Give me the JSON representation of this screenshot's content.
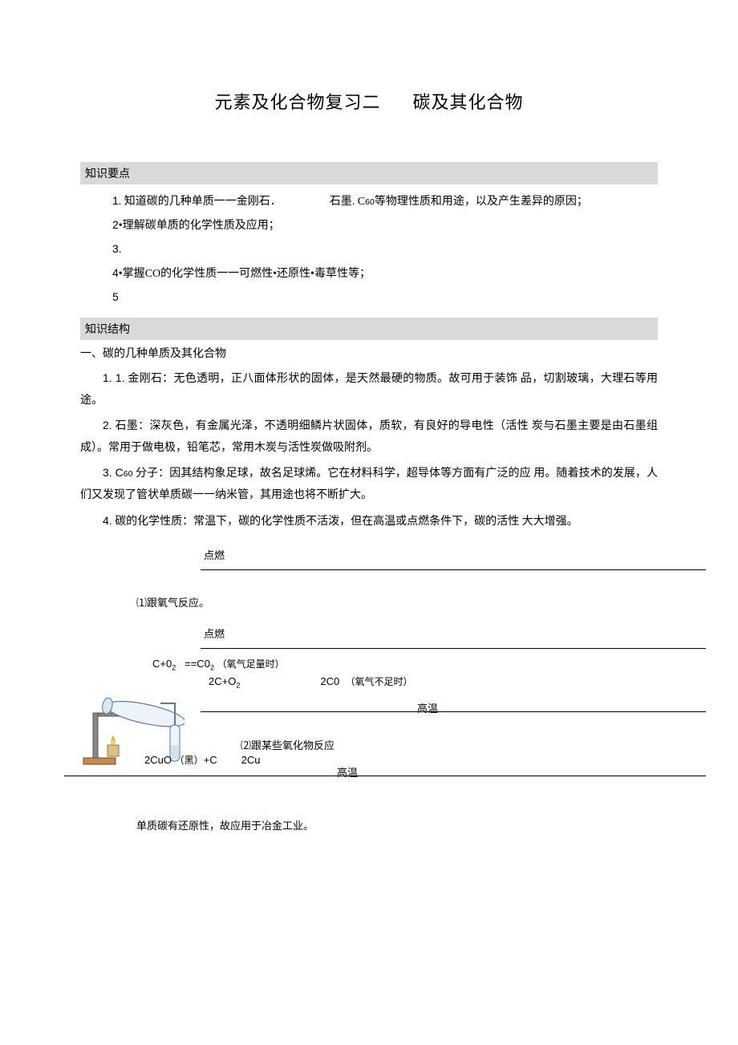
{
  "title": {
    "left": "元素及化合物复习二",
    "right": "碳及其化合物"
  },
  "sec1_header": "知识要点",
  "req": {
    "n1": "1",
    "t1a": " . 知道碳的几种单质一一金刚石．",
    "t1b": "石墨. C",
    "t1c": "60",
    "t1d": "等物理性质和用途，以及产生差异的原因；",
    "n2": "2",
    "t2": " •理解碳单质的化学性质及应用；",
    "n3": "3.",
    "n4": "4",
    "t4": "•掌握CO的化学性质一一可燃性•还原性•毒草性等；",
    "n5": "5"
  },
  "sec2_header": "知识结构",
  "subhead1": "一、碳的几种单质及其化合物",
  "p1": {
    "num": "1.   1.",
    "text": "金刚石：无色透明，正八面体形状的固体，是天然最硬的物质。故可用于装饰 品，切割玻璃，大理石等用途。"
  },
  "p2": {
    "num": "2.",
    "text": "石墨：深灰色，有金属光泽，不透明细鳞片状固体，质软，有良好的导电性（活性 炭与石墨主要是由石墨组成）。常用于做电极，铅笔芯，常用木炭与活性炭做吸附剂。"
  },
  "p3": {
    "num": "3.   C",
    "sub": "60",
    "text": "分子：因其结构象足球，故名足球烯。它在材料科学，超导体等方面有广泛的应 用。随着技术的发展，人们又发现了管状单质碳一一纳米管，其用途也将不断扩大。"
  },
  "p4": {
    "num": "4.",
    "text": "碳的化学性质：常温下，碳的化学性质不活泼，但在高温或点燃条件下，碳的活性 大大增强。"
  },
  "label_ignite": "点燃",
  "react1_title": "⑴跟氧气反应。",
  "eq1": {
    "lhs": "C+0",
    "sub1": "2",
    "eq": "==C0",
    "sub2": "2",
    "note": "（氧气足量时）"
  },
  "eq2": {
    "lhs": "2C+O",
    "sub1": "2",
    "rhs": "2C0",
    "note": "（氧气不足时）"
  },
  "label_hi": "高温",
  "react2_title": "⑵跟某些氧化物反应",
  "eq3": {
    "lhs": "2CuO",
    "paren": "（黑）",
    "plus": "+C",
    "rhs": "2Cu"
  },
  "final": "单质碳有还原性，故应用于冶金工业。"
}
